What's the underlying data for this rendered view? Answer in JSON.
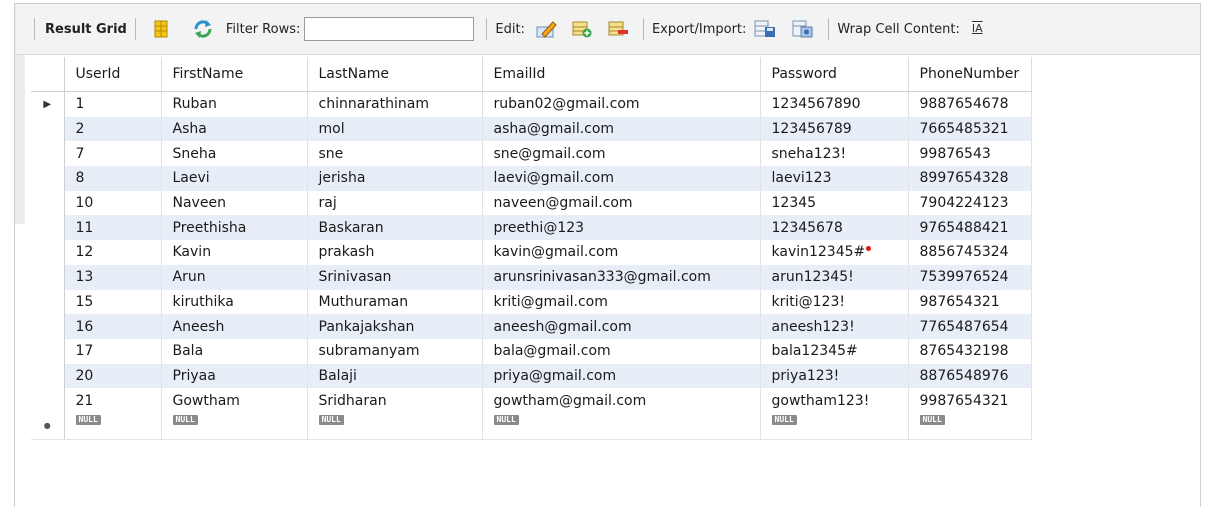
{
  "toolbar": {
    "result_grid": "Result Grid",
    "filter_rows": "Filter Rows:",
    "filter_value": "",
    "edit": "Edit:",
    "export_import": "Export/Import:",
    "wrap_cell": "Wrap Cell Content:",
    "wrap_icon_glyph": "IA"
  },
  "grid": {
    "columns": [
      "UserId",
      "FirstName",
      "LastName",
      "EmailId",
      "Password",
      "PhoneNumber"
    ],
    "rows": [
      [
        "1",
        "Ruban",
        "chinnarathinam",
        "ruban02@gmail.com",
        "1234567890",
        "9887654678"
      ],
      [
        "2",
        "Asha",
        "mol",
        "asha@gmail.com",
        "123456789",
        "7665485321"
      ],
      [
        "7",
        "Sneha",
        "sne",
        "sne@gmail.com",
        "sneha123!",
        "99876543"
      ],
      [
        "8",
        "Laevi",
        "jerisha",
        "laevi@gmail.com",
        "laevi123",
        "8997654328"
      ],
      [
        "10",
        "Naveen",
        "raj",
        "naveen@gmail.com",
        "12345",
        "7904224123"
      ],
      [
        "11",
        "Preethisha",
        "Baskaran",
        "preethi@123",
        "12345678",
        "9765488421"
      ],
      [
        "12",
        "Kavin",
        "prakash",
        "kavin@gmail.com",
        "kavin12345#",
        "8856745324"
      ],
      [
        "13",
        "Arun",
        "Srinivasan",
        "arunsrinivasan333@gmail.com",
        "arun12345!",
        "7539976524"
      ],
      [
        "15",
        "kiruthika",
        "Muthuraman",
        "kriti@gmail.com",
        "kriti@123!",
        "987654321"
      ],
      [
        "16",
        "Aneesh",
        "Pankajakshan",
        "aneesh@gmail.com",
        "aneesh123!",
        "7765487654"
      ],
      [
        "17",
        "Bala",
        "subramanyam",
        "bala@gmail.com",
        "bala12345#",
        "8765432198"
      ],
      [
        "20",
        "Priyaa",
        "Balaji",
        "priya@gmail.com",
        "priya123!",
        "8876548976"
      ],
      [
        "21",
        "Gowtham",
        "Sridharan",
        "gowtham@gmail.com",
        "gowtham123!",
        "9987654321"
      ]
    ],
    "null_label": "NULL",
    "current_row_marker": "▶",
    "new_row_marker": "●"
  },
  "colors": {
    "stripe": "#e8eef8",
    "null_chip": "#8a8a8a"
  }
}
